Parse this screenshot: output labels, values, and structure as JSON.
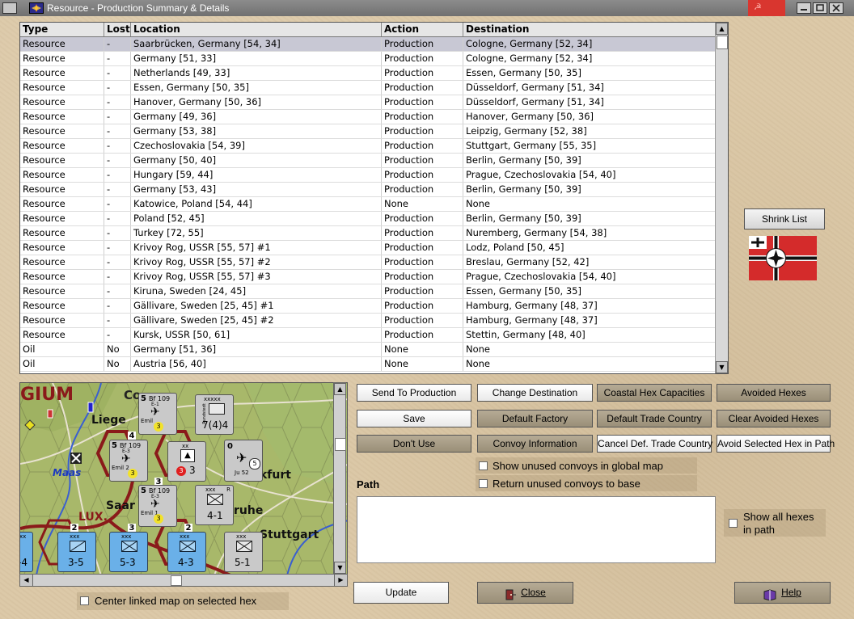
{
  "window": {
    "title": "Resource - Production Summary & Details"
  },
  "table": {
    "headers": [
      "Type",
      "Lost",
      "Location",
      "Action",
      "Destination"
    ],
    "rows": [
      [
        "Resource",
        "-",
        "Saarbrücken, Germany [54, 34]",
        "Production",
        "Cologne, Germany [52, 34]"
      ],
      [
        "Resource",
        "-",
        "Germany [51, 33]",
        "Production",
        "Cologne, Germany [52, 34]"
      ],
      [
        "Resource",
        "-",
        "Netherlands [49, 33]",
        "Production",
        "Essen, Germany [50, 35]"
      ],
      [
        "Resource",
        "-",
        "Essen, Germany [50, 35]",
        "Production",
        "Düsseldorf, Germany [51, 34]"
      ],
      [
        "Resource",
        "-",
        "Hanover, Germany [50, 36]",
        "Production",
        "Düsseldorf, Germany [51, 34]"
      ],
      [
        "Resource",
        "-",
        "Germany [49, 36]",
        "Production",
        "Hanover, Germany [50, 36]"
      ],
      [
        "Resource",
        "-",
        "Germany [53, 38]",
        "Production",
        "Leipzig, Germany [52, 38]"
      ],
      [
        "Resource",
        "-",
        "Czechoslovakia [54, 39]",
        "Production",
        "Stuttgart, Germany [55, 35]"
      ],
      [
        "Resource",
        "-",
        "Germany [50, 40]",
        "Production",
        "Berlin, Germany [50, 39]"
      ],
      [
        "Resource",
        "-",
        "Hungary [59, 44]",
        "Production",
        "Prague, Czechoslovakia [54, 40]"
      ],
      [
        "Resource",
        "-",
        "Germany [53, 43]",
        "Production",
        "Berlin, Germany [50, 39]"
      ],
      [
        "Resource",
        "-",
        "Katowice, Poland [54, 44]",
        "None",
        "None"
      ],
      [
        "Resource",
        "-",
        "Poland [52, 45]",
        "Production",
        "Berlin, Germany [50, 39]"
      ],
      [
        "Resource",
        "-",
        "Turkey [72, 55]",
        "Production",
        "Nuremberg, Germany [54, 38]"
      ],
      [
        "Resource",
        "-",
        "Krivoy Rog, USSR [55, 57] #1",
        "Production",
        "Lodz, Poland [50, 45]"
      ],
      [
        "Resource",
        "-",
        "Krivoy Rog, USSR [55, 57] #2",
        "Production",
        "Breslau, Germany [52, 42]"
      ],
      [
        "Resource",
        "-",
        "Krivoy Rog, USSR [55, 57] #3",
        "Production",
        "Prague, Czechoslovakia [54, 40]"
      ],
      [
        "Resource",
        "-",
        "Kiruna, Sweden [24, 45]",
        "Production",
        "Essen, Germany [50, 35]"
      ],
      [
        "Resource",
        "-",
        "Gällivare, Sweden [25, 45] #1",
        "Production",
        "Hamburg, Germany [48, 37]"
      ],
      [
        "Resource",
        "-",
        "Gällivare, Sweden [25, 45] #2",
        "Production",
        "Hamburg, Germany [48, 37]"
      ],
      [
        "Resource",
        "-",
        "Kursk, USSR [50, 61]",
        "Production",
        "Stettin, Germany [48, 40]"
      ],
      [
        "Oil",
        "No",
        "Germany [51, 36]",
        "None",
        "None"
      ],
      [
        "Oil",
        "No",
        "Austria [56, 40]",
        "None",
        "None"
      ]
    ]
  },
  "buttons": {
    "shrink_list": "Shrink List",
    "send_to_production": "Send To Production",
    "change_destination": "Change Destination",
    "coastal_hex_capacities": "Coastal Hex Capacities",
    "avoided_hexes": "Avoided Hexes",
    "save": "Save",
    "default_factory": "Default Factory",
    "default_trade_country": "Default Trade Country",
    "clear_avoided_hexes": "Clear Avoided Hexes",
    "dont_use": "Don't Use",
    "convoy_information": "Convoy Information",
    "cancel_def_trade_country": "Cancel Def. Trade Country",
    "avoid_selected_hex_in_path": "Avoid Selected Hex in Path",
    "update": "Update",
    "close": "Close",
    "help": "Help"
  },
  "checkboxes": {
    "show_unused_convoys": "Show unused convoys in global map",
    "return_unused_convoys": "Return unused convoys to base",
    "show_all_hexes_line1": "Show all hexes",
    "show_all_hexes_line2": "in path",
    "center_linked_map": "Center linked map on selected hex"
  },
  "path": {
    "label": "Path"
  },
  "map": {
    "labels": {
      "gium": "GIUM",
      "liege": "Liege",
      "maas": "Maas",
      "lux": "LUX.",
      "saar": "Saar",
      "kfurt": "kfurt",
      "ruhe": "ruhe",
      "stuttgart": "Stuttgart",
      "ca": "Co"
    },
    "units": [
      {
        "id": "bf109a",
        "title": "Bf 109",
        "sub": "E-1",
        "left": "5",
        "bottom": "Emil",
        "circle": "3"
      },
      {
        "id": "bf109b",
        "title": "Bf 109",
        "sub": "E-3",
        "left": "5",
        "bottom": "Emil 2",
        "circle": "3"
      },
      {
        "id": "bf109c",
        "title": "Bf 109",
        "sub": "E-3",
        "left": "5",
        "bottom": "Emil 1",
        "circle": "3"
      },
      {
        "id": "ju52",
        "title": "Ju 52",
        "left": "0",
        "right": "5"
      },
      {
        "id": "hq",
        "top": "xx",
        "value": "3",
        "circle": "3"
      },
      {
        "id": "gerr",
        "top": "xxxxx",
        "side": "Rundstedt",
        "value": "7(4)4"
      },
      {
        "id": "inf41",
        "top": "xxx",
        "side": "XXXX Gerr",
        "value": "4-1",
        "right": "R"
      },
      {
        "id": "cav35",
        "top": "xxx",
        "side": "XVIII Cav",
        "value": "3-5"
      },
      {
        "id": "inf53",
        "top": "xxx",
        "side": "XIII Inf",
        "value": "5-3"
      },
      {
        "id": "inf43",
        "top": "xxx",
        "side": "VIII Inf",
        "value": "4-3"
      },
      {
        "id": "inf51",
        "top": "xxx",
        "side": "XXXX Gerr",
        "value": "5-1"
      },
      {
        "id": "leftunit",
        "value": "-4",
        "top": "xx"
      }
    ],
    "stack_counts": {
      "a": "4",
      "b": "3",
      "c": "3",
      "d": "2",
      "e": "2"
    }
  },
  "colors": {
    "selected_row": "#c8c8d4",
    "title_bar": "#7a7a7a",
    "map_border_red": "#8a1a1a",
    "map_grass": "#a9b86a"
  }
}
